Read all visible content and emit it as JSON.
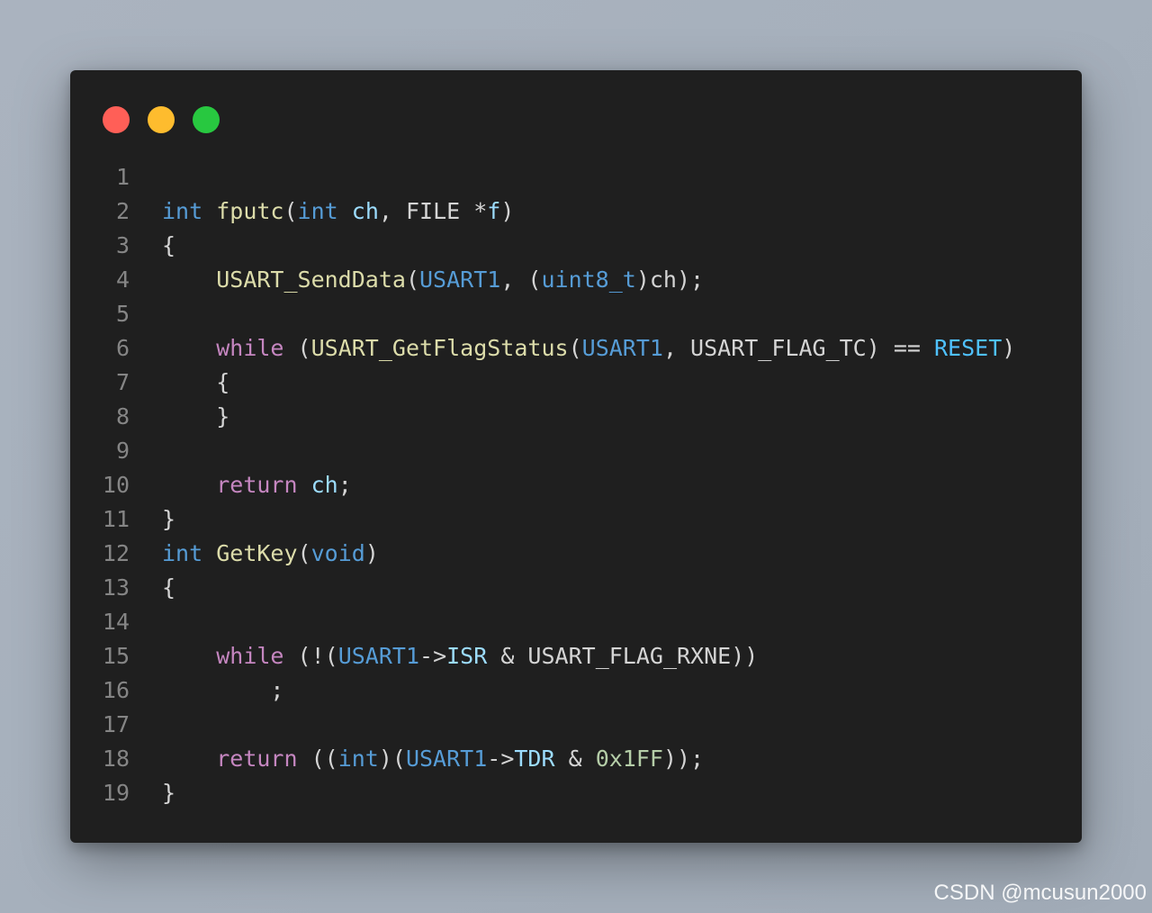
{
  "window": {
    "controls": [
      {
        "name": "close",
        "color": "#ff5f57"
      },
      {
        "name": "minimize",
        "color": "#febc2e"
      },
      {
        "name": "maximize",
        "color": "#28c840"
      }
    ]
  },
  "code": {
    "language": "c",
    "lines": [
      {
        "n": "1",
        "tokens": []
      },
      {
        "n": "2",
        "tokens": [
          {
            "t": "int",
            "c": "kw"
          },
          {
            "t": " ",
            "c": "pl"
          },
          {
            "t": "fputc",
            "c": "fn"
          },
          {
            "t": "(",
            "c": "pl"
          },
          {
            "t": "int",
            "c": "kw"
          },
          {
            "t": " ",
            "c": "pl"
          },
          {
            "t": "ch",
            "c": "var"
          },
          {
            "t": ", FILE *",
            "c": "pl"
          },
          {
            "t": "f",
            "c": "var"
          },
          {
            "t": ")",
            "c": "pl"
          }
        ]
      },
      {
        "n": "3",
        "tokens": [
          {
            "t": "{",
            "c": "pl"
          }
        ]
      },
      {
        "n": "4",
        "tokens": [
          {
            "t": "    ",
            "c": "pl"
          },
          {
            "t": "USART_SendData",
            "c": "fn"
          },
          {
            "t": "(",
            "c": "pl"
          },
          {
            "t": "USART1",
            "c": "kw"
          },
          {
            "t": ", (",
            "c": "pl"
          },
          {
            "t": "uint8_t",
            "c": "kw"
          },
          {
            "t": ")ch);",
            "c": "pl"
          }
        ]
      },
      {
        "n": "5",
        "tokens": []
      },
      {
        "n": "6",
        "tokens": [
          {
            "t": "    ",
            "c": "pl"
          },
          {
            "t": "while",
            "c": "ctl"
          },
          {
            "t": " (",
            "c": "pl"
          },
          {
            "t": "USART_GetFlagStatus",
            "c": "fn"
          },
          {
            "t": "(",
            "c": "pl"
          },
          {
            "t": "USART1",
            "c": "kw"
          },
          {
            "t": ", USART_FLAG_TC) == ",
            "c": "pl"
          },
          {
            "t": "RESET",
            "c": "mac"
          },
          {
            "t": ")",
            "c": "pl"
          }
        ]
      },
      {
        "n": "7",
        "tokens": [
          {
            "t": "    {",
            "c": "pl"
          }
        ]
      },
      {
        "n": "8",
        "tokens": [
          {
            "t": "    }",
            "c": "pl"
          }
        ]
      },
      {
        "n": "9",
        "tokens": []
      },
      {
        "n": "10",
        "tokens": [
          {
            "t": "    ",
            "c": "pl"
          },
          {
            "t": "return",
            "c": "ctl"
          },
          {
            "t": " ",
            "c": "pl"
          },
          {
            "t": "ch",
            "c": "var"
          },
          {
            "t": ";",
            "c": "pl"
          }
        ]
      },
      {
        "n": "11",
        "tokens": [
          {
            "t": "}",
            "c": "pl"
          }
        ]
      },
      {
        "n": "12",
        "tokens": [
          {
            "t": "int",
            "c": "kw"
          },
          {
            "t": " ",
            "c": "pl"
          },
          {
            "t": "GetKey",
            "c": "fn"
          },
          {
            "t": "(",
            "c": "pl"
          },
          {
            "t": "void",
            "c": "kw"
          },
          {
            "t": ")",
            "c": "pl"
          }
        ]
      },
      {
        "n": "13",
        "tokens": [
          {
            "t": "{",
            "c": "pl"
          }
        ]
      },
      {
        "n": "14",
        "tokens": []
      },
      {
        "n": "15",
        "tokens": [
          {
            "t": "    ",
            "c": "pl"
          },
          {
            "t": "while",
            "c": "ctl"
          },
          {
            "t": " (!(",
            "c": "pl"
          },
          {
            "t": "USART1",
            "c": "kw"
          },
          {
            "t": "->",
            "c": "pl"
          },
          {
            "t": "ISR",
            "c": "var"
          },
          {
            "t": " & USART_FLAG_RXNE))",
            "c": "pl"
          }
        ]
      },
      {
        "n": "16",
        "tokens": [
          {
            "t": "        ;",
            "c": "pl"
          }
        ]
      },
      {
        "n": "17",
        "tokens": []
      },
      {
        "n": "18",
        "tokens": [
          {
            "t": "    ",
            "c": "pl"
          },
          {
            "t": "return",
            "c": "ctl"
          },
          {
            "t": " ((",
            "c": "pl"
          },
          {
            "t": "int",
            "c": "kw"
          },
          {
            "t": ")(",
            "c": "pl"
          },
          {
            "t": "USART1",
            "c": "kw"
          },
          {
            "t": "->",
            "c": "pl"
          },
          {
            "t": "TDR",
            "c": "var"
          },
          {
            "t": " & ",
            "c": "pl"
          },
          {
            "t": "0x1FF",
            "c": "num"
          },
          {
            "t": "));",
            "c": "pl"
          }
        ]
      },
      {
        "n": "19",
        "tokens": [
          {
            "t": "}",
            "c": "pl"
          }
        ]
      }
    ]
  },
  "watermark": {
    "text": "CSDN @mcusun2000"
  }
}
